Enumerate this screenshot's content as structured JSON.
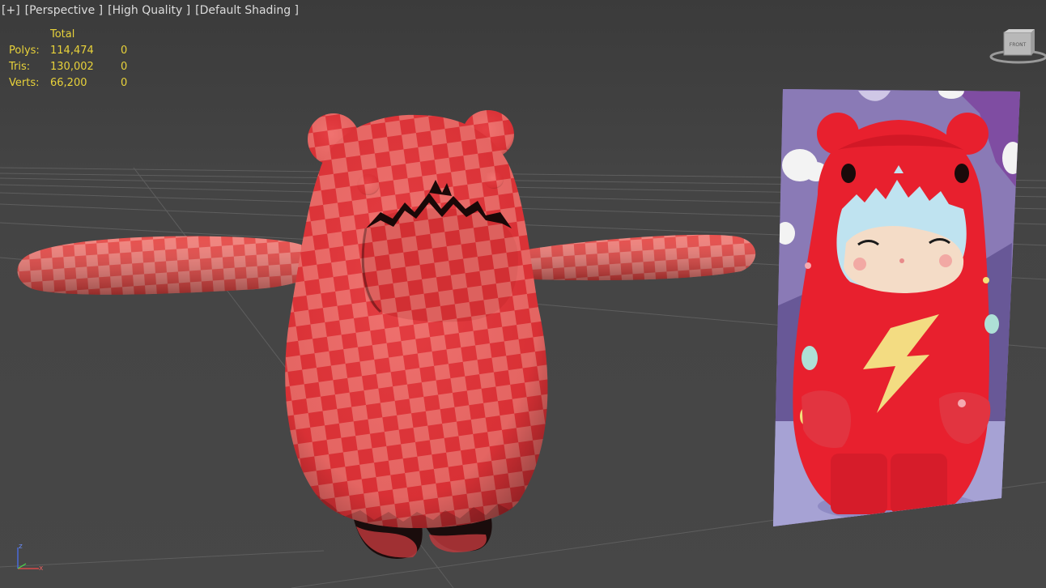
{
  "viewport": {
    "menu": {
      "plus": "[+]",
      "view": "[Perspective ]",
      "quality": "[High Quality ]",
      "shading": "[Default Shading ]"
    },
    "stats": {
      "header": "Total",
      "rows": [
        {
          "label": "Polys:",
          "total": "114,474",
          "selected": "0"
        },
        {
          "label": "Tris:",
          "total": "130,002",
          "selected": "0"
        },
        {
          "label": "Verts:",
          "total": "66,200",
          "selected": "0"
        }
      ]
    },
    "viewcube": {
      "label": "FRONT"
    },
    "axis": {
      "z": "z",
      "x": "x"
    }
  },
  "colors": {
    "check_dark": "#e8393b",
    "check_light": "#f5716d",
    "doll_red": "#e8202e",
    "reference_bg": "#8d7db8"
  }
}
